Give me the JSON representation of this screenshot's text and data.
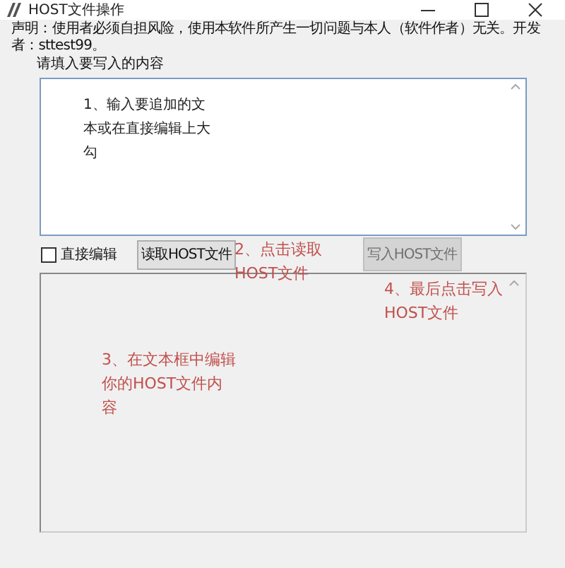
{
  "window": {
    "title": "HOST文件操作"
  },
  "declaration": "声明：使用者必须自担风险，使用本软件所产生一切问题与本人（软件作者）无关。开发者：sttest99。",
  "prompt": "请填入要写入的内容",
  "input_box": {
    "value": "1、输入要追加的文本或在直接编辑上大勾"
  },
  "direct_edit": {
    "label": "直接编辑",
    "checked": false
  },
  "buttons": [
    {
      "label": "读取HOST文件",
      "disabled": false
    },
    {
      "label": "写入HOST文件",
      "disabled": true
    }
  ],
  "annotations": [
    {
      "text": "2、点击读取HOST文件"
    },
    {
      "text": "4、最后点击写入HOST文件"
    },
    {
      "text": "3、在文本框中编辑你的HOST文件内容"
    }
  ]
}
